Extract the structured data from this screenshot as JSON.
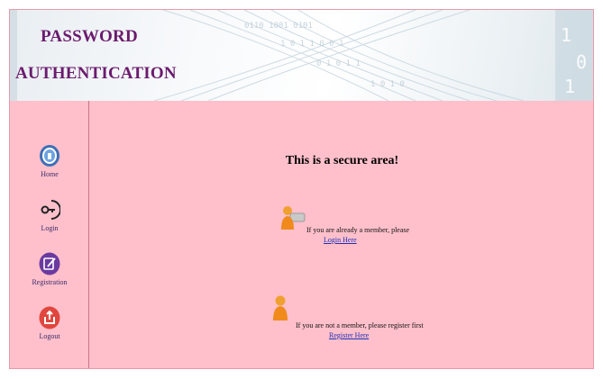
{
  "header": {
    "title_line1": "PASSWORD",
    "title_line2": "AUTHENTICATION"
  },
  "sidebar": {
    "items": [
      {
        "label": "Home",
        "icon": "home-icon",
        "color": "#3f6fb7"
      },
      {
        "label": "Login",
        "icon": "key-icon",
        "color": "#222222"
      },
      {
        "label": "Registration",
        "icon": "edit-icon",
        "color": "#6b3aa0"
      },
      {
        "label": "Logout",
        "icon": "logout-icon",
        "color": "#e0463e"
      }
    ]
  },
  "main": {
    "heading": "This is a secure area!",
    "existing_member": {
      "text": "If you are already a member, please",
      "link": "Login Here"
    },
    "new_member": {
      "text": "If you are not a member, please register first",
      "link": "Register Here"
    }
  },
  "colors": {
    "background": "#ffc0cb",
    "title": "#6b1b6e",
    "link": "#1d2fb5"
  }
}
